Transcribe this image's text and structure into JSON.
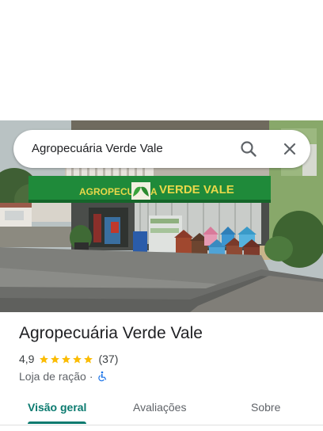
{
  "search": {
    "query": "Agropecuária Verde Vale"
  },
  "photo": {
    "sign_left": "AGROPECUÁRIA",
    "sign_right": "VERDE VALE"
  },
  "place": {
    "title": "Agropecuária Verde Vale",
    "rating": "4,9",
    "stars": 5,
    "review_count": "(37)",
    "category": "Loja de ração",
    "separator": "·"
  },
  "tabs": [
    {
      "label": "Visão geral",
      "active": true
    },
    {
      "label": "Avaliações",
      "active": false
    },
    {
      "label": "Sobre",
      "active": false
    }
  ],
  "colors": {
    "accent": "#0a7a6f",
    "star": "#fbbc04",
    "wheelchair": "#1a73e8",
    "sign_green": "#1f8a3a",
    "sign_text": "#e8d84a"
  }
}
